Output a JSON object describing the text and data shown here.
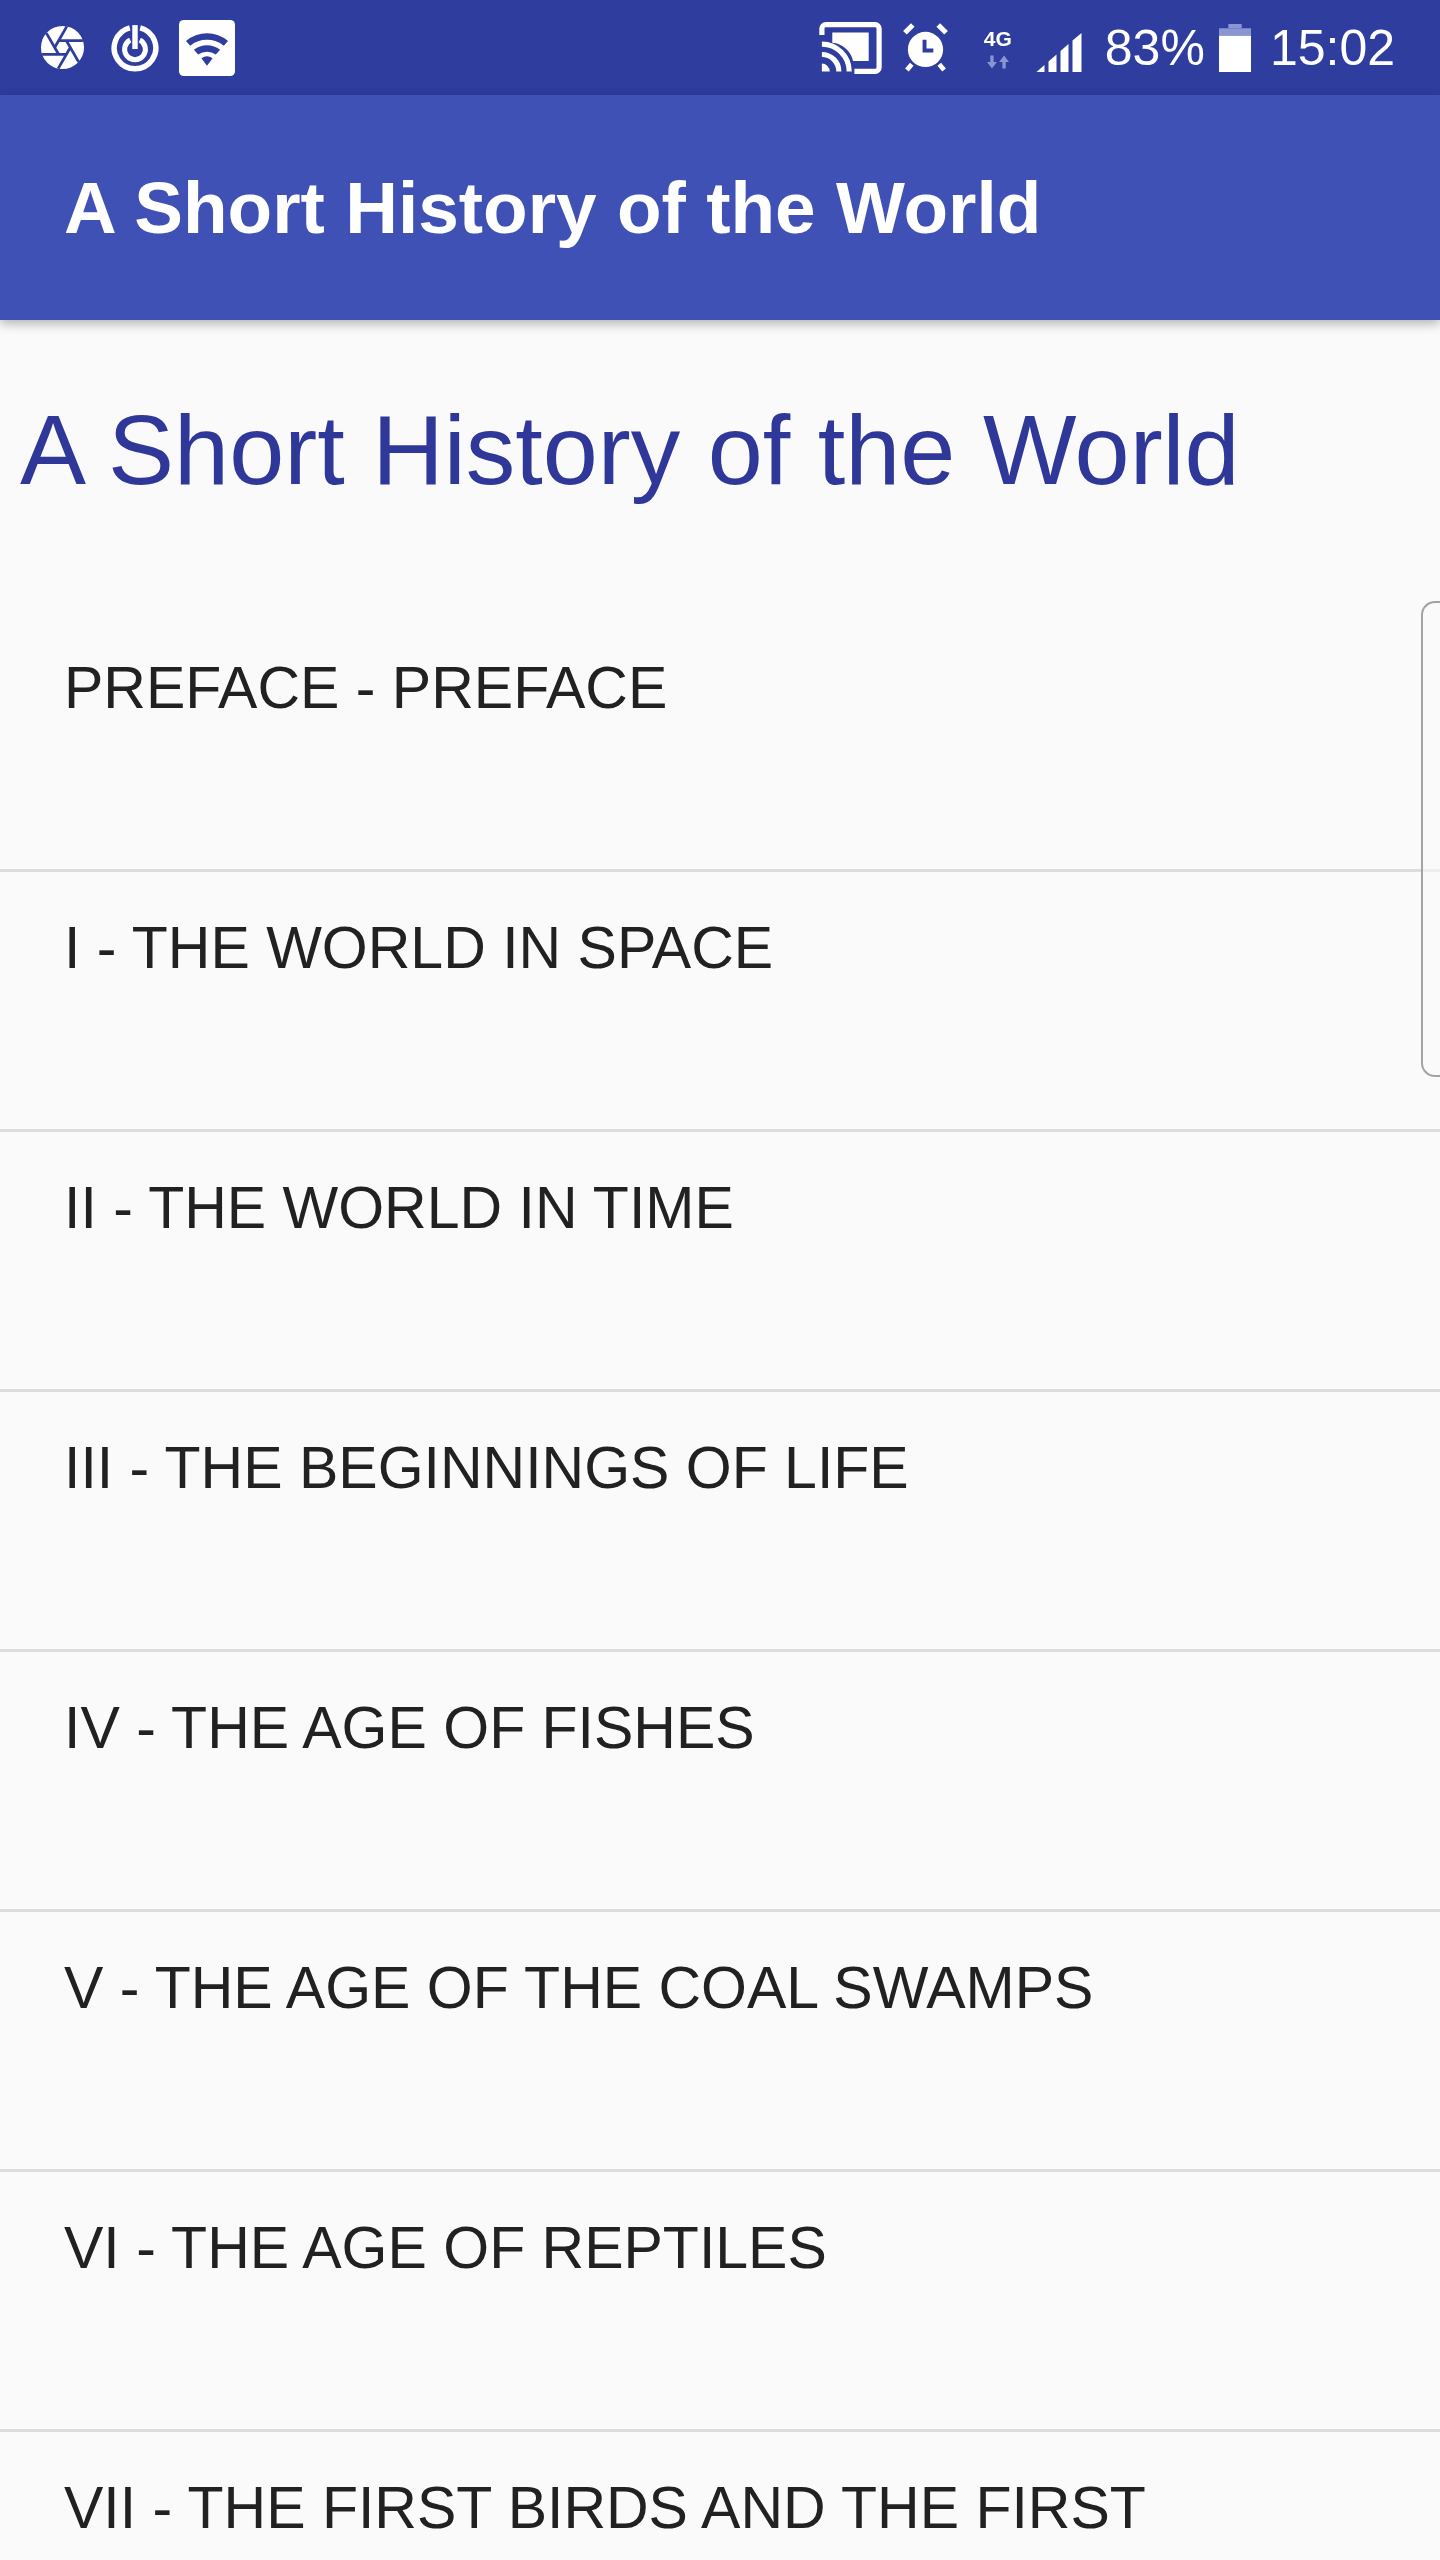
{
  "status_bar": {
    "network": "4G",
    "battery": "83%",
    "time": "15:02"
  },
  "app_bar": {
    "title": "A Short History of the World"
  },
  "heading": "A Short History of the World",
  "chapters": [
    "PREFACE - PREFACE",
    "I - THE WORLD IN SPACE",
    "II - THE WORLD IN TIME",
    "III - THE BEGINNINGS OF LIFE",
    "IV - THE AGE OF FISHES",
    "V - THE AGE OF THE COAL SWAMPS",
    "VI - THE AGE OF REPTILES",
    "VII - THE FIRST BIRDS AND THE FIRST"
  ]
}
